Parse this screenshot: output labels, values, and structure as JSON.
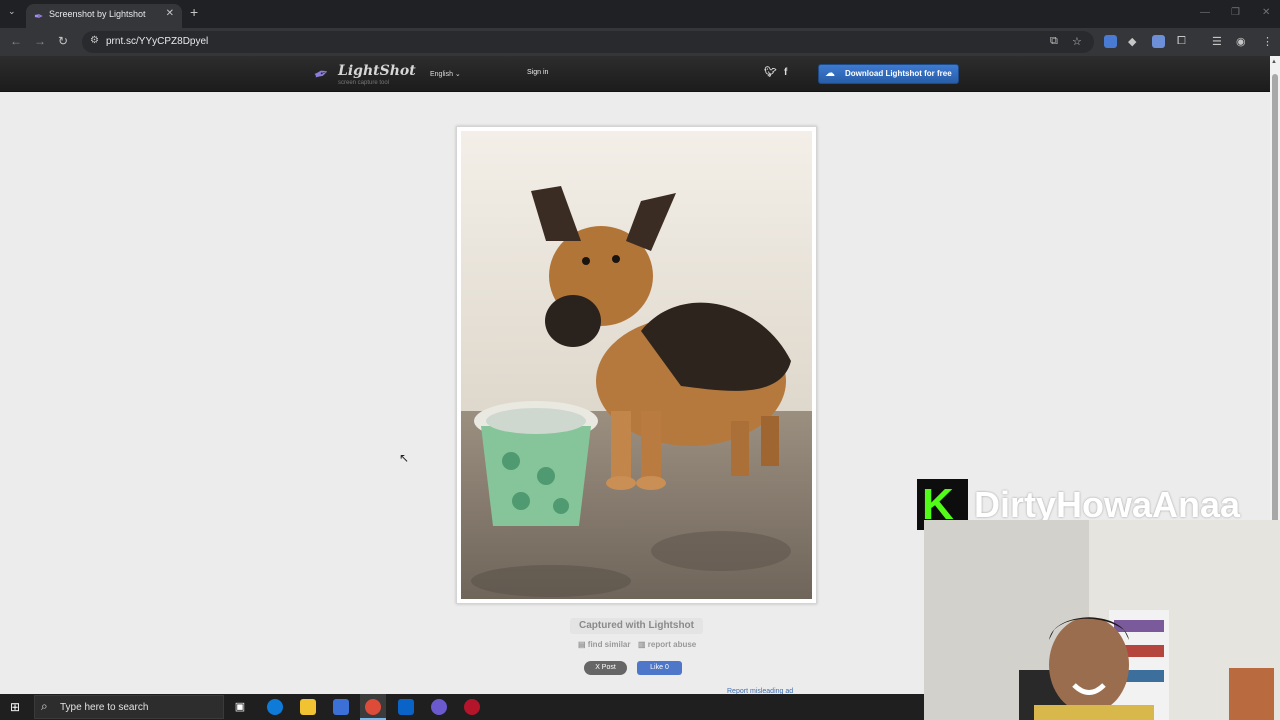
{
  "browser": {
    "tab_title": "Screenshot by Lightshot",
    "tab_close": "✕",
    "new_tab": "+",
    "url": "prnt.sc/YYyCPZ8Dpyel"
  },
  "site": {
    "logo_text": "LightShot",
    "logo_tagline": "screen capture tool",
    "language": "English",
    "sign_in": "Sign in",
    "download_button": "Download Lightshot for free",
    "captured_label": "Captured with Lightshot",
    "find_similar": "find similar",
    "report_abuse": "report abuse",
    "x_post": "X Post",
    "fb_like": "Like 0",
    "report_ad": "Report misleading ad"
  },
  "overlay": {
    "streamer_name": "DirtyHowaAnaa",
    "platform_logo_letter": "K",
    "brand_color": "#53fc18"
  },
  "taskbar": {
    "search_placeholder": "Type here to search"
  }
}
